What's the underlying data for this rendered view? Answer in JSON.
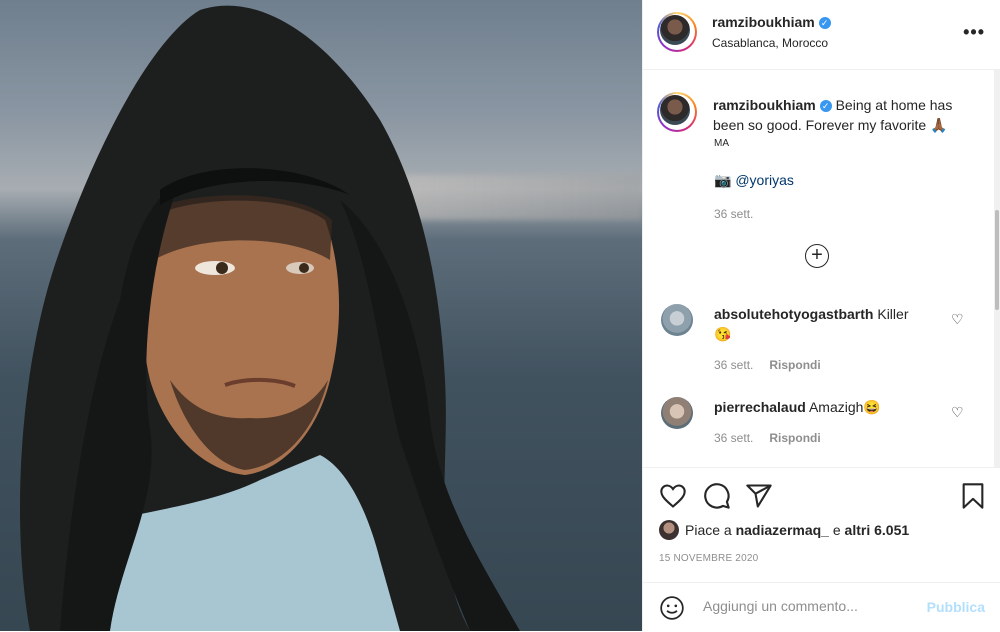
{
  "post": {
    "username": "ramziboukhiam",
    "location": "Casablanca, Morocco",
    "more_label": "•••"
  },
  "caption": {
    "username": "ramziboukhiam",
    "text": "Being at home has been so good. Forever my favorite 🙏🏾",
    "tag": "MA",
    "credit_emoji": "📷",
    "credit_handle": "@yoriyas",
    "time": "36 sett."
  },
  "comments": [
    {
      "username": "absolutehotyogastbarth",
      "text": "Killer",
      "emoji": "😘",
      "time": "36 sett.",
      "reply": "Rispondi"
    },
    {
      "username": "pierrechalaud",
      "text": "Amazigh😆",
      "time": "36 sett.",
      "reply": "Rispondi"
    }
  ],
  "likes": {
    "prefix": "Piace a",
    "user": "nadiazermaq_",
    "middle": "e",
    "others": "altri 6.051"
  },
  "date": "15 NOVEMBRE 2020",
  "add_comment": {
    "placeholder": "Aggiungi un commento...",
    "publish": "Pubblica"
  },
  "colors": {
    "verified": "#3897f0",
    "publish_disabled": "#b2dffc",
    "secondary_text": "#8e8e8e"
  },
  "icons": [
    "heart-icon",
    "comment-icon",
    "share-icon",
    "bookmark-icon",
    "emoji-icon",
    "verified-icon",
    "load-more-icon",
    "more-options-icon"
  ]
}
